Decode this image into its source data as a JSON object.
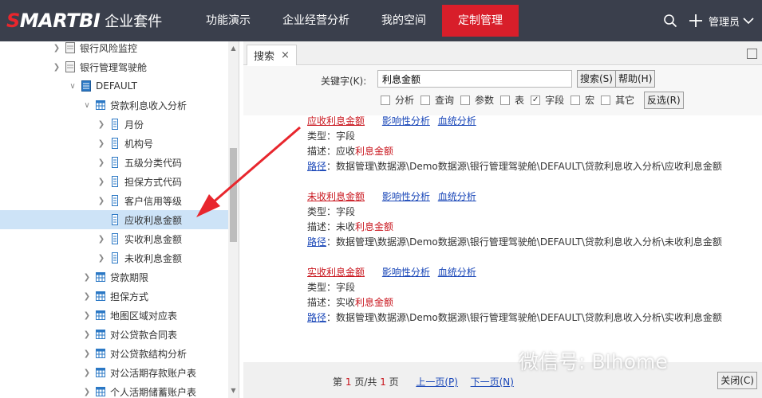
{
  "header": {
    "logo_text": "SMARTBI",
    "suite_text": "企业套件",
    "nav": [
      "功能演示",
      "企业经营分析",
      "我的空间",
      "定制管理"
    ],
    "active_nav": "定制管理",
    "user": "管理员"
  },
  "tree": {
    "items": [
      {
        "label": "银行风险监控",
        "icon": "folder-page-icon"
      },
      {
        "label": "银行管理驾驶舱",
        "icon": "folder-page-icon"
      },
      {
        "label": "DEFAULT",
        "icon": "database-icon"
      },
      {
        "label": "贷款利息收入分析",
        "icon": "table-icon"
      },
      {
        "label": "月份",
        "icon": "field-icon"
      },
      {
        "label": "机构号",
        "icon": "field-icon"
      },
      {
        "label": "五级分类代码",
        "icon": "field-icon"
      },
      {
        "label": "担保方式代码",
        "icon": "field-icon"
      },
      {
        "label": "客户信用等级",
        "icon": "field-icon"
      },
      {
        "label": "应收利息金额",
        "icon": "field-icon"
      },
      {
        "label": "实收利息金额",
        "icon": "field-icon"
      },
      {
        "label": "未收利息金额",
        "icon": "field-icon"
      },
      {
        "label": "贷款期限",
        "icon": "table-icon"
      },
      {
        "label": "担保方式",
        "icon": "table-icon"
      },
      {
        "label": "地图区域对应表",
        "icon": "table-icon"
      },
      {
        "label": "对公贷款合同表",
        "icon": "table-icon"
      },
      {
        "label": "对公贷款结构分析",
        "icon": "table-icon"
      },
      {
        "label": "对公活期存款账户表",
        "icon": "table-icon"
      },
      {
        "label": "个人活期储蓄账户表",
        "icon": "table-icon"
      }
    ]
  },
  "tab": {
    "label": "搜索",
    "close": "×"
  },
  "search": {
    "keyword_label": "关键字(K):",
    "keyword_value": "利息金额",
    "search_button": "搜索(S)",
    "help_button": "帮助(H)",
    "options": [
      {
        "label": "分析",
        "checked": false
      },
      {
        "label": "查询",
        "checked": false
      },
      {
        "label": "参数",
        "checked": false
      },
      {
        "label": "表",
        "checked": false
      },
      {
        "label": "字段",
        "checked": true
      },
      {
        "label": "宏",
        "checked": false
      },
      {
        "label": "其它",
        "checked": false
      }
    ],
    "invert_button": "反选(R)"
  },
  "results": [
    {
      "name_prefix": "应收",
      "name_highlight": "利息金额",
      "impact_link": "影响性分析",
      "lineage_link": "血统分析",
      "type_label": "类型：",
      "type_value": "字段",
      "desc_label": "描述：",
      "desc_prefix": "应收",
      "desc_highlight": "利息金额",
      "path_label": "路径",
      "path_value": "：数据管理\\数据源\\Demo数据源\\银行管理驾驶舱\\DEFAULT\\贷款利息收入分析\\应收利息金额"
    },
    {
      "name_prefix": "未收",
      "name_highlight": "利息金额",
      "impact_link": "影响性分析",
      "lineage_link": "血统分析",
      "type_label": "类型：",
      "type_value": "字段",
      "desc_label": "描述：",
      "desc_prefix": "未收",
      "desc_highlight": "利息金额",
      "path_label": "路径",
      "path_value": "：数据管理\\数据源\\Demo数据源\\银行管理驾驶舱\\DEFAULT\\贷款利息收入分析\\未收利息金额"
    },
    {
      "name_prefix": "实收",
      "name_highlight": "利息金额",
      "impact_link": "影响性分析",
      "lineage_link": "血统分析",
      "type_label": "类型：",
      "type_value": "字段",
      "desc_label": "描述：",
      "desc_prefix": "实收",
      "desc_highlight": "利息金额",
      "path_label": "路径",
      "path_value": "：数据管理\\数据源\\Demo数据源\\银行管理驾驶舱\\DEFAULT\\贷款利息收入分析\\实收利息金额"
    }
  ],
  "pager": {
    "page_prefix": "第",
    "current_page": "1",
    "page_mid": "页/共",
    "total_pages": "1",
    "page_suffix": "页",
    "prev": "上一页(P)",
    "next": "下一页(N)"
  },
  "close_button": "关闭(C)",
  "watermark": "微信号: BIhome",
  "colors": {
    "topbar": "#3a3f4c",
    "active_nav": "#d81e2a",
    "highlight": "#c9161e",
    "link": "#1a47b8",
    "arrow": "#e8262d"
  }
}
